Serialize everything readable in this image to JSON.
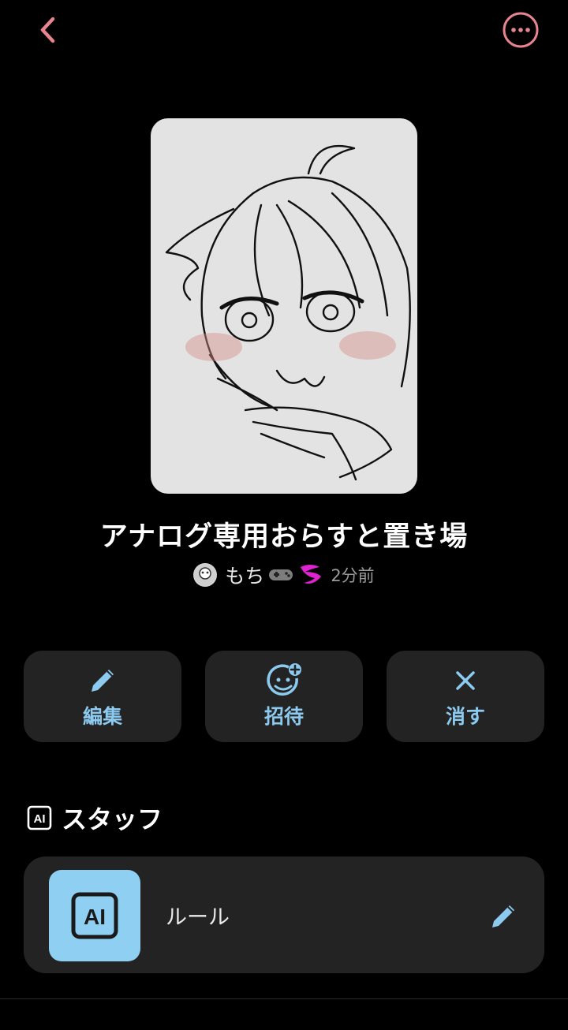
{
  "header": {
    "back_icon": "chevron-left-icon",
    "more_icon": "more-horizontal-icon",
    "accent_color": "#e8848f"
  },
  "post": {
    "title": "アナログ専用おらすと置き場",
    "author": "もち",
    "author_emoji": [
      "gamepad-icon",
      "paint-palette-icon"
    ],
    "time": "2分前"
  },
  "actions": [
    {
      "label": "編集",
      "icon": "pencil-icon"
    },
    {
      "label": "招待",
      "icon": "add-user-icon"
    },
    {
      "label": "消す",
      "icon": "close-icon"
    }
  ],
  "staff": {
    "section_title": "スタッフ",
    "section_icon": "ai-badge-icon",
    "items": [
      {
        "name": "ルール",
        "icon": "ai-badge-icon",
        "edit_icon": "pencil-icon"
      }
    ]
  },
  "colors": {
    "background": "#000000",
    "card": "#232323",
    "action_label": "#8ccaf0",
    "staff_icon_bg": "#8fd0f2"
  }
}
